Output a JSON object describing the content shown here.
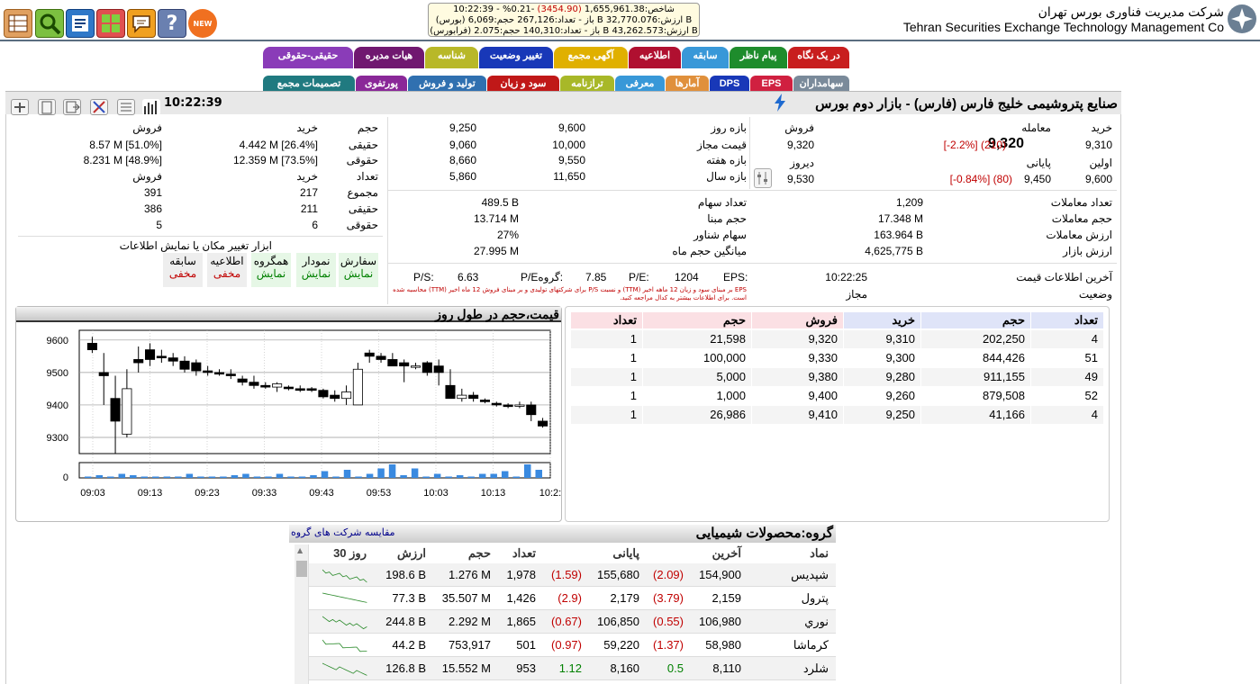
{
  "header": {
    "org_fa": "شرکت مدیریت فناوری بورس تهران",
    "org_en": "Tehran Securities Exchange Technology Management Co",
    "ticker": {
      "line1_prefix": "شاخص:",
      "line1_value": "1,655,961.38",
      "line1_change": "(3454.90)",
      "line1_pct": "-0.21%",
      "line1_time": "- 10:22:39",
      "line2": "(بورس) باز - تعداد:267,126 حجم:6,069 B ارزش:32,770.076 B",
      "line3": "(فرابورس) باز - تعداد:140,310 حجم:2.075 B ارزش:43,262.573 B"
    },
    "new_badge": "NEW",
    "icons": [
      "table-icon",
      "search-icon",
      "news-icon",
      "grid-icon",
      "chat-icon",
      "help-icon",
      "new-icon"
    ]
  },
  "tabs_row1": [
    "در یک نگاه",
    "پیام ناظر",
    "سابقه",
    "اطلاعیه",
    "آگهی مجمع",
    "تغییر وضعیت",
    "شناسه",
    "هیات مدیره",
    "حقیقی-حقوقی"
  ],
  "tabs_row2": [
    "سهامداران",
    "EPS",
    "DPS",
    "آمارها",
    "معرفی",
    "ترازنامه",
    "سود و زیان",
    "تولید و فروش",
    "پورتفوی",
    "تصمیمات مجمع"
  ],
  "titlebar": {
    "title": "صنایع پتروشیمی خلیج فارس (فارس) - بازار دوم بورس",
    "time": "10:22:39"
  },
  "price_info": {
    "buy_label": "خرید",
    "trade_label": "معامله",
    "sell_label": "فروش",
    "buy_value": "9,310",
    "trade_value": "9,320",
    "trade_change": "(210)",
    "trade_pct": "[-2.2%]",
    "sell_value": "9,320",
    "first_label": "اولین",
    "final_label": "پایانی",
    "yesterday_label": "دیروز",
    "first_value": "9,600",
    "final_value": "9,450",
    "final_change": "(80)",
    "final_pct": "[-0.84%]",
    "yesterday_value": "9,530"
  },
  "ranges": {
    "rows": [
      {
        "label": "بازه روز",
        "low": "9,600",
        "high": "9,250"
      },
      {
        "label": "قیمت مجاز",
        "low": "10,000",
        "high": "9,060"
      },
      {
        "label": "بازه هفته",
        "low": "9,550",
        "high": "8,660"
      },
      {
        "label": "بازه سال",
        "low": "11,650",
        "high": "5,860"
      }
    ]
  },
  "legal": {
    "h_volume": "حجم",
    "h_buy": "خرید",
    "h_sell": "فروش",
    "real": "حقیقی",
    "legal": "حقوقی",
    "real_buy": "4.442 M [26.4%]",
    "real_sell": "8.57 M [51.0%]",
    "legal_buy": "12.359 M [73.5%]",
    "legal_sell": "8.231 M [48.9%]",
    "h_count": "تعداد",
    "total": "مجموع",
    "total_buy": "217",
    "total_sell": "391",
    "real_buy_count": "211",
    "real_sell_count": "386",
    "legal_buy_count": "6",
    "legal_sell_count": "5"
  },
  "trades": [
    {
      "label": "تعداد معاملات",
      "value": "1,209"
    },
    {
      "label": "حجم معاملات",
      "value": "17.348 M"
    },
    {
      "label": "ارزش معاملات",
      "value": "163.964 B"
    },
    {
      "label": "ارزش بازار",
      "value": "4,625,775 B"
    }
  ],
  "shares": [
    {
      "label": "تعداد سهام",
      "value": "489.5 B"
    },
    {
      "label": "حجم مبنا",
      "value": "13.714 M"
    },
    {
      "label": "سهام شناور",
      "value": "27%"
    },
    {
      "label": "میانگین حجم ماه",
      "value": "27.995 M"
    }
  ],
  "status": {
    "last_update_label": "آخرین اطلاعات قیمت",
    "last_update": "10:22:25",
    "state_label": "وضعیت",
    "state": "مجاز",
    "eps_label": "EPS:",
    "eps": "1204",
    "pe_label": "P/E:",
    "pe": "7.85",
    "gpe_label": "P/Eگروه:",
    "gpe": "6.63",
    "ps_label": "P/S:",
    "note": "EPS بر مبنای سود و زیان 12 ماهه اخیر (TTM) و نسبت P/S برای شرکتهای تولیدی و بر مبنای فروش 12 ماه اخیر (TTM) محاسبه شده است. برای اطلاعات بیشتر به کدال مراجعه کنید."
  },
  "display_tools": {
    "title": "ابزار تغییر مکان یا نمایش اطلاعات",
    "items": [
      {
        "name": "سفارش",
        "state": "نمایش"
      },
      {
        "name": "نمودار",
        "state": "نمایش"
      },
      {
        "name": "همگروه",
        "state": "نمایش"
      },
      {
        "name": "اطلاعیه",
        "state": "مخفی"
      },
      {
        "name": "سابقه",
        "state": "مخفی"
      }
    ]
  },
  "chart_data": {
    "type": "candlestick",
    "title": "قیمت،حجم در طول روز",
    "ylim": [
      9250,
      9630
    ],
    "yticks": [
      "9600",
      "9500",
      "9400",
      "9300"
    ],
    "vol_ticks": [
      "0"
    ],
    "xticks": [
      "09:03",
      "09:13",
      "09:23",
      "09:33",
      "09:43",
      "09:53",
      "10:03",
      "10:13",
      "10:2:"
    ],
    "candles": [
      {
        "o": 9590,
        "h": 9610,
        "l": 9560,
        "c": 9570
      },
      {
        "o": 9500,
        "h": 9560,
        "l": 9400,
        "c": 9490
      },
      {
        "o": 9420,
        "h": 9490,
        "l": 9250,
        "c": 9350
      },
      {
        "o": 9310,
        "h": 9510,
        "l": 9300,
        "c": 9450
      },
      {
        "o": 9540,
        "h": 9580,
        "l": 9500,
        "c": 9530
      },
      {
        "o": 9570,
        "h": 9590,
        "l": 9520,
        "c": 9540
      },
      {
        "o": 9550,
        "h": 9570,
        "l": 9530,
        "c": 9545
      },
      {
        "o": 9545,
        "h": 9560,
        "l": 9520,
        "c": 9535
      },
      {
        "o": 9535,
        "h": 9550,
        "l": 9500,
        "c": 9510
      },
      {
        "o": 9530,
        "h": 9540,
        "l": 9490,
        "c": 9505
      },
      {
        "o": 9505,
        "h": 9520,
        "l": 9490,
        "c": 9500
      },
      {
        "o": 9500,
        "h": 9510,
        "l": 9490,
        "c": 9495
      },
      {
        "o": 9495,
        "h": 9510,
        "l": 9480,
        "c": 9490
      },
      {
        "o": 9480,
        "h": 9490,
        "l": 9460,
        "c": 9470
      },
      {
        "o": 9470,
        "h": 9490,
        "l": 9450,
        "c": 9460
      },
      {
        "o": 9460,
        "h": 9470,
        "l": 9450,
        "c": 9455
      },
      {
        "o": 9455,
        "h": 9470,
        "l": 9440,
        "c": 9465
      },
      {
        "o": 9455,
        "h": 9460,
        "l": 9445,
        "c": 9450
      },
      {
        "o": 9450,
        "h": 9460,
        "l": 9440,
        "c": 9445
      },
      {
        "o": 9450,
        "h": 9455,
        "l": 9440,
        "c": 9445
      },
      {
        "o": 9445,
        "h": 9450,
        "l": 9420,
        "c": 9425
      },
      {
        "o": 9430,
        "h": 9445,
        "l": 9410,
        "c": 9420
      },
      {
        "o": 9420,
        "h": 9460,
        "l": 9400,
        "c": 9440
      },
      {
        "o": 9400,
        "h": 9530,
        "l": 9400,
        "c": 9510
      },
      {
        "o": 9560,
        "h": 9570,
        "l": 9530,
        "c": 9550
      },
      {
        "o": 9550,
        "h": 9560,
        "l": 9530,
        "c": 9540
      },
      {
        "o": 9540,
        "h": 9560,
        "l": 9520,
        "c": 9520
      },
      {
        "o": 9530,
        "h": 9540,
        "l": 9470,
        "c": 9520
      },
      {
        "o": 9520,
        "h": 9530,
        "l": 9510,
        "c": 9520
      },
      {
        "o": 9530,
        "h": 9535,
        "l": 9490,
        "c": 9500
      },
      {
        "o": 9520,
        "h": 9540,
        "l": 9460,
        "c": 9500
      },
      {
        "o": 9460,
        "h": 9510,
        "l": 9420,
        "c": 9420
      },
      {
        "o": 9420,
        "h": 9450,
        "l": 9410,
        "c": 9430
      },
      {
        "o": 9430,
        "h": 9440,
        "l": 9410,
        "c": 9420
      },
      {
        "o": 9415,
        "h": 9420,
        "l": 9405,
        "c": 9410
      },
      {
        "o": 9405,
        "h": 9410,
        "l": 9395,
        "c": 9400
      },
      {
        "o": 9400,
        "h": 9405,
        "l": 9390,
        "c": 9395
      },
      {
        "o": 9400,
        "h": 9410,
        "l": 9390,
        "c": 9400
      },
      {
        "o": 9400,
        "h": 9410,
        "l": 9350,
        "c": 9370
      },
      {
        "o": 9350,
        "h": 9360,
        "l": 9330,
        "c": 9335
      }
    ],
    "volumes": [
      0.1,
      0.2,
      0.1,
      0.3,
      0.2,
      0.1,
      0.1,
      0.1,
      0.1,
      0.3,
      0.1,
      0.1,
      0.1,
      0.2,
      0.3,
      0.1,
      0.1,
      0.3,
      0.1,
      0.1,
      0.2,
      0.5,
      0.1,
      0.6,
      0.1,
      0.3,
      0.7,
      1.0,
      0.2,
      0.7,
      0.1,
      0.3,
      0.1,
      0.2,
      0.1,
      0.3,
      0.3,
      0.5,
      0.1,
      1.0,
      0.6
    ]
  },
  "orderbook": {
    "headers": [
      "تعداد",
      "حجم",
      "خرید",
      "فروش",
      "حجم",
      "تعداد"
    ],
    "rows": [
      {
        "bc": "4",
        "bv": "202,250",
        "bp": "9,310",
        "sp": "9,320",
        "sv": "21,598",
        "sc": "1"
      },
      {
        "bc": "51",
        "bv": "844,426",
        "bp": "9,300",
        "sp": "9,330",
        "sv": "100,000",
        "sc": "1"
      },
      {
        "bc": "49",
        "bv": "911,155",
        "bp": "9,280",
        "sp": "9,380",
        "sv": "5,000",
        "sc": "1"
      },
      {
        "bc": "52",
        "bv": "879,508",
        "bp": "9,260",
        "sp": "9,400",
        "sv": "1,000",
        "sc": "1"
      },
      {
        "bc": "4",
        "bv": "41,166",
        "bp": "9,250",
        "sp": "9,410",
        "sv": "26,986",
        "sc": "1"
      }
    ]
  },
  "group": {
    "title": "گروه:محصولات شیمیایی",
    "compare_link": "مقایسه شرکت های گروه",
    "headers": [
      "نماد",
      "آخرین",
      "پایانی",
      "تعداد",
      "حجم",
      "ارزش",
      "30 روز"
    ],
    "rows": [
      {
        "sym": "شپدیس",
        "last": "154,900",
        "lastch": "(2.09)",
        "fin": "155,680",
        "finch": "(1.59)",
        "cnt": "1,978",
        "vol": "1.276 M",
        "val": "198.6 B",
        "dir": "neg"
      },
      {
        "sym": "پترول",
        "last": "2,159",
        "lastch": "(3.79)",
        "fin": "2,179",
        "finch": "(2.9)",
        "cnt": "1,426",
        "vol": "35.507 M",
        "val": "77.3 B",
        "dir": "neg"
      },
      {
        "sym": "نوري",
        "last": "106,980",
        "lastch": "(0.55)",
        "fin": "106,850",
        "finch": "(0.67)",
        "cnt": "1,865",
        "vol": "2.292 M",
        "val": "244.8 B",
        "dir": "neg"
      },
      {
        "sym": "كرماشا",
        "last": "58,980",
        "lastch": "(1.37)",
        "fin": "59,220",
        "finch": "(0.97)",
        "cnt": "501",
        "vol": "753,917",
        "val": "44.2 B",
        "dir": "neg"
      },
      {
        "sym": "شلرد",
        "last": "8,110",
        "lastch": "0.5",
        "fin": "8,160",
        "finch": "1.12",
        "cnt": "953",
        "vol": "15.552 M",
        "val": "126.8 B",
        "dir": "pos"
      }
    ]
  }
}
